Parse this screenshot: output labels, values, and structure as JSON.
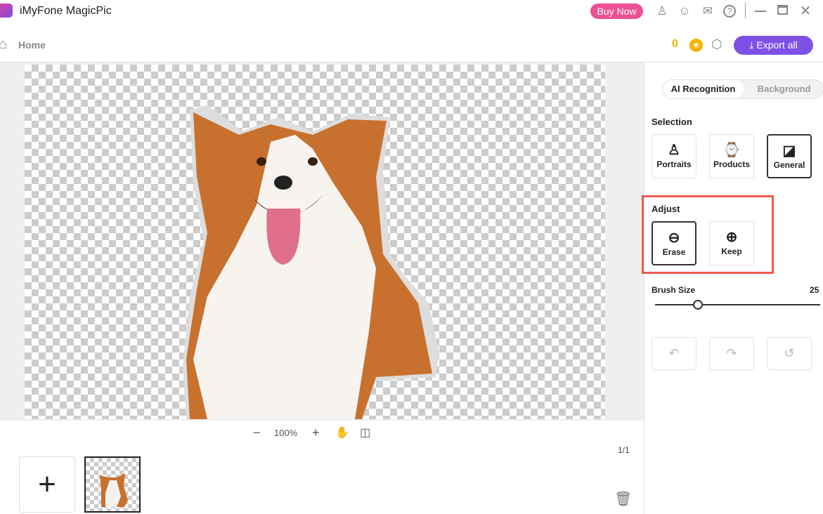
{
  "app": {
    "title": "iMyFone MagicPic",
    "buy_now": "Buy Now"
  },
  "titlebar_icons": [
    "user-icon",
    "discord-icon",
    "mail-icon",
    "help-icon",
    "minimize-icon",
    "maximize-icon",
    "close-icon"
  ],
  "toolbar": {
    "home": "Home",
    "credits": "0",
    "export_all": "Export all"
  },
  "zoom": {
    "level": "100%"
  },
  "thumbnails": {
    "page": "1/1"
  },
  "panel": {
    "tabs": [
      {
        "label": "AI Recognition",
        "active": true
      },
      {
        "label": "Background",
        "active": false
      }
    ],
    "selection_title": "Selection",
    "selection": [
      {
        "label": "Portraits"
      },
      {
        "label": "Products"
      },
      {
        "label": "General",
        "selected": true
      }
    ],
    "adjust_title": "Adjust",
    "adjust": [
      {
        "label": "Erase",
        "selected": true
      },
      {
        "label": "Keep"
      }
    ],
    "brush_label": "Brush Size",
    "brush_value": "25"
  },
  "colors": {
    "accent": "#7e51e6",
    "buy": "#ee4f95",
    "highlight": "#f05a50",
    "credit": "#f4b000"
  }
}
